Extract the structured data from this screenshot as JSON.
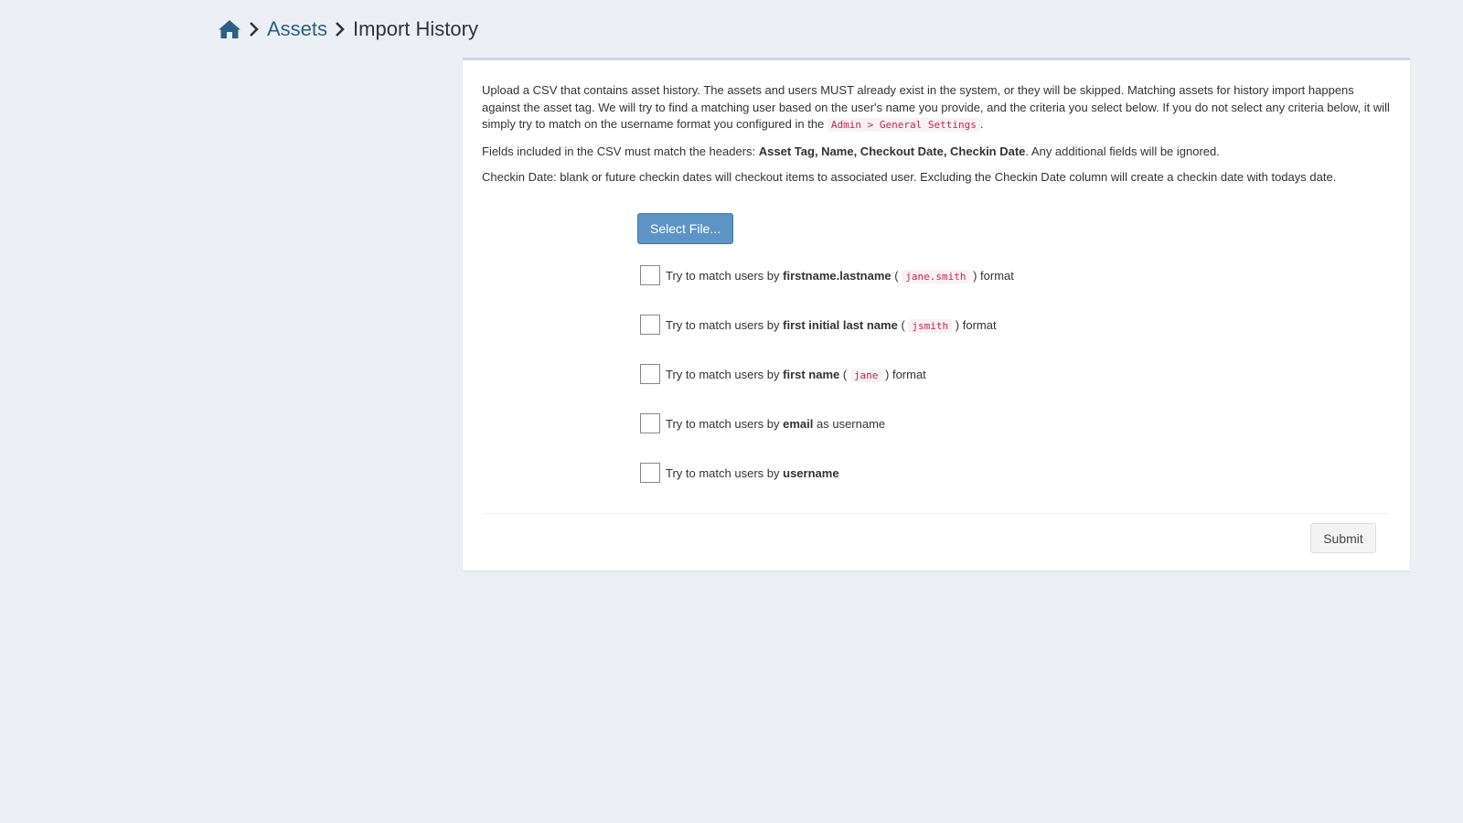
{
  "breadcrumb": {
    "home_icon": "home-icon",
    "items": [
      "Assets",
      "Import History"
    ]
  },
  "colors": {
    "background": "#ecf0f5",
    "link": "#2c5f85",
    "primary_button": "#5c94c5",
    "code_text": "#c7254e"
  },
  "description": {
    "p1_text": "Upload a CSV that contains asset history. The assets and users MUST already exist in the system, or they will be skipped. Matching assets for history import happens against the asset tag. We will try to find a matching user based on the user's name you provide, and the criteria you select below. If you do not select any criteria below, it will simply try to match on the username format you configured in the",
    "p1_code": "Admin > General Settings",
    "p1_end": ".",
    "p2_pre": "Fields included in the CSV must match the headers:",
    "p2_bold": "Asset Tag, Name, Checkout Date, Checkin Date",
    "p2_post": ". Any additional fields will be ignored.",
    "p3": "Checkin Date: blank or future checkin dates will checkout items to associated user. Excluding the Checkin Date column will create a checkin date with todays date."
  },
  "select_file_label": "Select File...",
  "options": [
    {
      "prefix": "Try to match users by",
      "bold": "firstname.lastname",
      "open": "(",
      "code": "jane.smith",
      "close": ")",
      "suffix": "format",
      "checked": false
    },
    {
      "prefix": "Try to match users by",
      "bold": "first initial last name",
      "open": "(",
      "code": "jsmith",
      "close": ")",
      "suffix": "format",
      "checked": false
    },
    {
      "prefix": "Try to match users by",
      "bold": "first name",
      "open": "(",
      "code": "jane",
      "close": ")",
      "suffix": "format",
      "checked": false
    },
    {
      "prefix": "Try to match users by",
      "bold": "email",
      "suffix": "as username",
      "checked": false
    },
    {
      "prefix": "Try to match users by",
      "bold": "username",
      "checked": false
    }
  ],
  "submit_label": "Submit"
}
